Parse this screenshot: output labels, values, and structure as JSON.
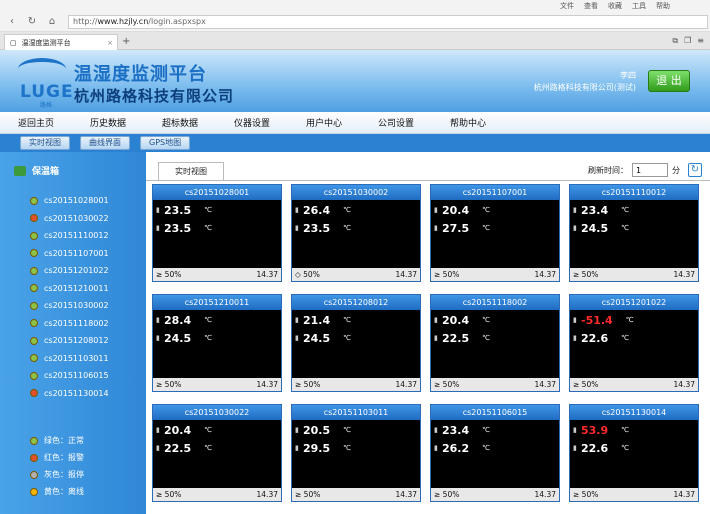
{
  "browser": {
    "menu": [
      "文件",
      "查看",
      "收藏",
      "工具",
      "帮助"
    ],
    "url_prefix": "http://",
    "url_host": "www.hzjly.cn",
    "url_path": "/login.aspxspx",
    "tab_title": "温湿度监测平台"
  },
  "header": {
    "logo_text": "LUGE",
    "logo_sub": "路格",
    "title": "温湿度监测平台",
    "company": "杭州路格科技有限公司",
    "user_name": "李四",
    "user_org": "杭州路格科技有限公司(测试)",
    "logout_label": "退 出"
  },
  "menu": [
    "返回主页",
    "历史数据",
    "超标数据",
    "仪器设置",
    "用户中心",
    "公司设置",
    "帮助中心"
  ],
  "subnav": [
    "实时视图",
    "曲线界面",
    "GPS地图"
  ],
  "sidebar": {
    "title": "保温箱",
    "devices": [
      {
        "name": "cs20151028001",
        "color": "#8bc34a"
      },
      {
        "name": "cs20151030022",
        "color": "#e0502a"
      },
      {
        "name": "cs20151110012",
        "color": "#8bc34a"
      },
      {
        "name": "cs20151107001",
        "color": "#8bc34a"
      },
      {
        "name": "cs20151201022",
        "color": "#8bc34a"
      },
      {
        "name": "cs20151210011",
        "color": "#8bc34a"
      },
      {
        "name": "cs20151030002",
        "color": "#8bc34a"
      },
      {
        "name": "cs20151118002",
        "color": "#8bc34a"
      },
      {
        "name": "cs20151208012",
        "color": "#8bc34a"
      },
      {
        "name": "cs20151103011",
        "color": "#8bc34a"
      },
      {
        "name": "cs20151106015",
        "color": "#8bc34a"
      },
      {
        "name": "cs20151130014",
        "color": "#e0502a"
      }
    ],
    "legend": [
      {
        "label": "绿色：正常",
        "color": "#8bc34a"
      },
      {
        "label": "红色：报警",
        "color": "#e0502a"
      },
      {
        "label": "灰色：报停",
        "color": "#b0b0b0"
      },
      {
        "label": "黄色：离线",
        "color": "#f5b400"
      }
    ]
  },
  "content": {
    "tab_label": "实时视图",
    "refresh_label": "刷新时间：",
    "refresh_value": "1",
    "refresh_unit": "分",
    "unit": "℃",
    "cards": [
      {
        "id": "cs20151028001",
        "t1": "23.5",
        "t2": "23.5",
        "t1_red": false,
        "hum": "≥ 50%",
        "volt": "14.37"
      },
      {
        "id": "cs20151030002",
        "t1": "26.4",
        "t2": "23.5",
        "t1_red": false,
        "hum": "◇ 50%",
        "volt": "14.37"
      },
      {
        "id": "cs20151107001",
        "t1": "20.4",
        "t2": "27.5",
        "t1_red": false,
        "hum": "≥ 50%",
        "volt": "14.37"
      },
      {
        "id": "cs20151110012",
        "t1": "23.4",
        "t2": "24.5",
        "t1_red": false,
        "hum": "≥ 50%",
        "volt": "14.37"
      },
      {
        "id": "cs20151210011",
        "t1": "28.4",
        "t2": "24.5",
        "t1_red": false,
        "hum": "≥ 50%",
        "volt": "14.37"
      },
      {
        "id": "cs20151208012",
        "t1": "21.4",
        "t2": "24.5",
        "t1_red": false,
        "hum": "≥ 50%",
        "volt": "14.37"
      },
      {
        "id": "cs20151118002",
        "t1": "20.4",
        "t2": "22.5",
        "t1_red": false,
        "hum": "≥ 50%",
        "volt": "14.37"
      },
      {
        "id": "cs20151201022",
        "t1": "-51.4",
        "t2": "22.6",
        "t1_red": true,
        "hum": "≥ 50%",
        "volt": "14.37"
      },
      {
        "id": "cs20151030022",
        "t1": "20.4",
        "t2": "22.5",
        "t1_red": false,
        "hum": "≥ 50%",
        "volt": "14.37"
      },
      {
        "id": "cs20151103011",
        "t1": "20.5",
        "t2": "29.5",
        "t1_red": false,
        "hum": "≥ 50%",
        "volt": "14.37"
      },
      {
        "id": "cs20151106015",
        "t1": "23.4",
        "t2": "26.2",
        "t1_red": false,
        "hum": "≥ 50%",
        "volt": "14.37"
      },
      {
        "id": "cs20151130014",
        "t1": "53.9",
        "t2": "22.6",
        "t1_red": true,
        "hum": "≥ 50%",
        "volt": "14.37"
      }
    ]
  }
}
